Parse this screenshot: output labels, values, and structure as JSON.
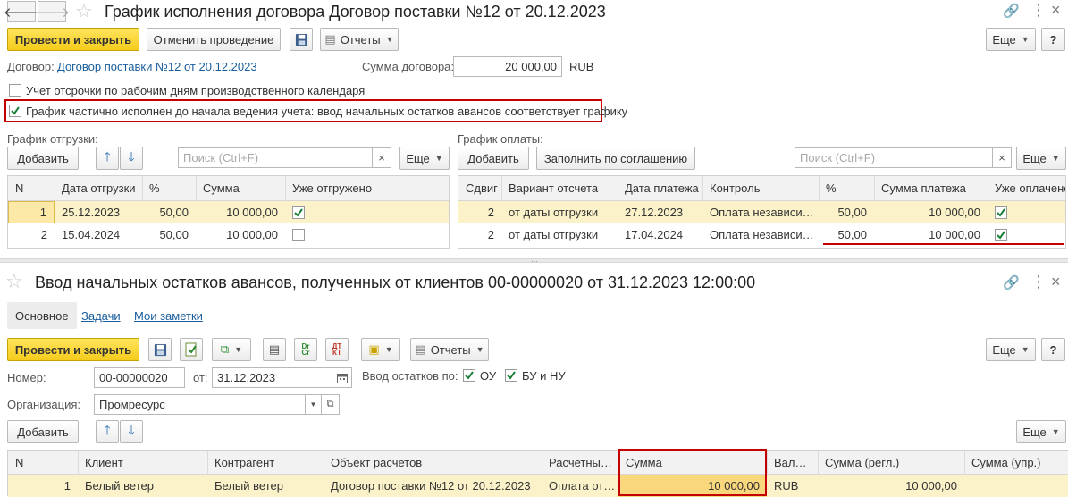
{
  "schedule": {
    "title": "График исполнения договора Договор поставки №12 от 20.12.2023",
    "post_close_label": "Провести и закрыть",
    "cancel_posting_label": "Отменить проведение",
    "reports_label": "Отчеты",
    "more_label": "Еще",
    "help_label": "?",
    "contract_label": "Договор:",
    "contract_value": "Договор поставки №12 от 20.12.2023",
    "contract_sum_label": "Сумма договора:",
    "contract_sum_value": "20 000,00",
    "currency": "RUB",
    "calendar_checkbox_label": "Учет отсрочки по рабочим дням производственного календаря",
    "partial_checkbox_label": "График частично исполнен до начала ведения учета: ввод начальных остатков авансов соответствует графику",
    "shipment": {
      "title": "График отгрузки:",
      "add_label": "Добавить",
      "search_placeholder": "Поиск (Ctrl+F)",
      "more_label": "Еще",
      "columns": [
        "N",
        "Дата отгрузки",
        "%",
        "Сумма",
        "Уже отгружено"
      ],
      "rows": [
        {
          "n": "1",
          "date": "25.12.2023",
          "pct": "50,00",
          "sum": "10 000,00",
          "done": true
        },
        {
          "n": "2",
          "date": "15.04.2024",
          "pct": "50,00",
          "sum": "10 000,00",
          "done": false
        }
      ]
    },
    "payment": {
      "title": "График оплаты:",
      "add_label": "Добавить",
      "fill_label": "Заполнить по соглашению",
      "search_placeholder": "Поиск (Ctrl+F)",
      "more_label": "Еще",
      "columns": [
        "Сдвиг",
        "Вариант отсчета",
        "Дата платежа",
        "Контроль",
        "%",
        "Сумма платежа",
        "Уже оплачено"
      ],
      "rows": [
        {
          "shift": "2",
          "variant": "от даты отгрузки",
          "date": "27.12.2023",
          "control": "Оплата независи…",
          "pct": "50,00",
          "sum": "10 000,00",
          "paid": true
        },
        {
          "shift": "2",
          "variant": "от даты отгрузки",
          "date": "17.04.2024",
          "control": "Оплата независи…",
          "pct": "50,00",
          "sum": "10 000,00",
          "paid": true
        }
      ]
    }
  },
  "advances": {
    "title": "Ввод начальных остатков авансов, полученных от клиентов 00-00000020 от 31.12.2023 12:00:00",
    "tabs": [
      "Основное",
      "Задачи",
      "Мои заметки"
    ],
    "post_close_label": "Провести и закрыть",
    "reports_label": "Отчеты",
    "more_label": "Еще",
    "help_label": "?",
    "number_label": "Номер:",
    "number_value": "00-00000020",
    "from_label": "от:",
    "date_value": "31.12.2023",
    "balances_by_label": "Ввод остатков по:",
    "ou_label": "ОУ",
    "bu_nu_label": "БУ и НУ",
    "org_label": "Организация:",
    "org_value": "Промресурс",
    "add_label": "Добавить",
    "table_more_label": "Еще",
    "dt_kt_icon_text": "ДТ КТ",
    "dr_cr_icon_text": "Dr Cr",
    "columns": [
      "N",
      "Клиент",
      "Контрагент",
      "Объект расчетов",
      "Расчетны…",
      "Сумма",
      "Вал…",
      "Сумма (регл.)",
      "Сумма (упр.)"
    ],
    "rows": [
      {
        "n": "1",
        "client": "Белый ветер",
        "counterparty": "Белый ветер",
        "object": "Договор поставки №12 от 20.12.2023",
        "settlement": "Оплата от…",
        "sum": "10 000,00",
        "currency": "RUB",
        "sum_reg": "10 000,00",
        "sum_mgmt": ""
      }
    ]
  },
  "colors": {
    "primary_button": "#f5cb1c",
    "highlight_border": "#c40000",
    "selected_row": "#fbf2c9",
    "link": "#1a5e9e",
    "check_green": "#1a7f37"
  }
}
